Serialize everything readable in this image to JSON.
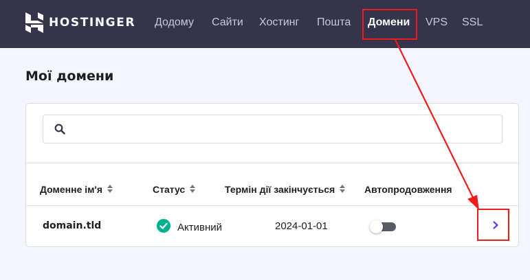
{
  "brand": {
    "name": "HOSTINGER"
  },
  "nav": {
    "items": [
      {
        "label": "Додому"
      },
      {
        "label": "Сайти"
      },
      {
        "label": "Хостинг"
      },
      {
        "label": "Пошта"
      },
      {
        "label": "Домени",
        "active": true
      },
      {
        "label": "VPS"
      },
      {
        "label": "SSL"
      }
    ]
  },
  "page": {
    "title": "Мої домени"
  },
  "search": {
    "value": "",
    "placeholder": ""
  },
  "table": {
    "columns": [
      "Доменне ім'я",
      "Статус",
      "Термін дії закінчується",
      "Автопродовження"
    ],
    "rows": [
      {
        "domain": "domain.tld",
        "status": "Активний",
        "expires": "2024-01-01",
        "auto_renew": false
      }
    ]
  },
  "colors": {
    "topbar": "#36344d",
    "accent": "#673de6",
    "status_ok": "#00b090",
    "highlight": "#ee1c1c"
  },
  "icons": [
    "logo-icon",
    "search-icon",
    "sort-icon",
    "check-circle-icon",
    "chevron-right-icon"
  ]
}
